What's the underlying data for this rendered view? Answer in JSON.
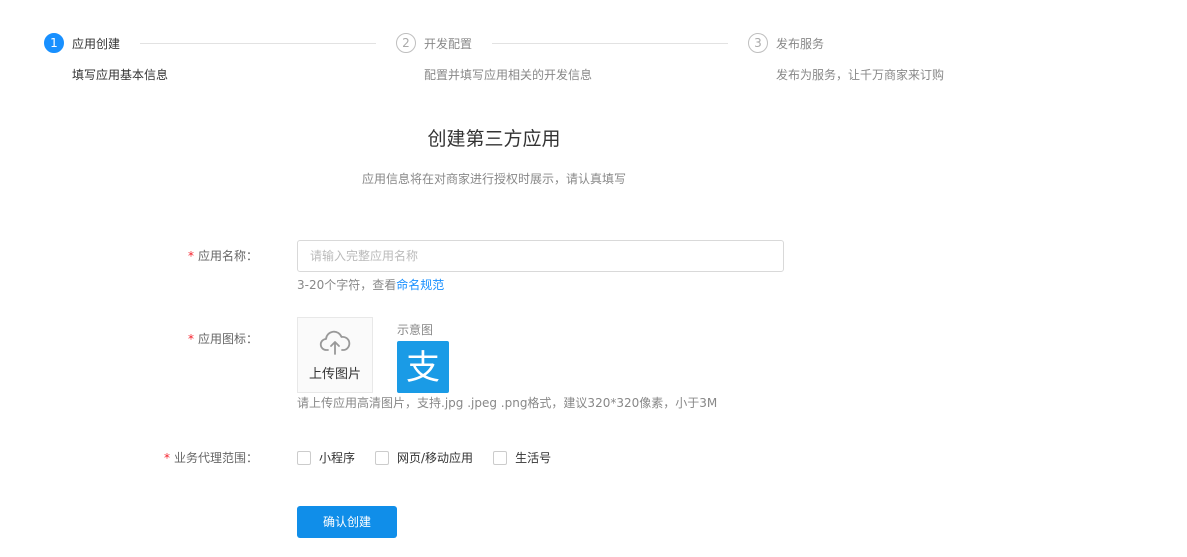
{
  "steps": [
    {
      "number": "1",
      "title": "应用创建",
      "desc": "填写应用基本信息",
      "state": "active"
    },
    {
      "number": "2",
      "title": "开发配置",
      "desc": "配置并填写应用相关的开发信息",
      "state": "inactive"
    },
    {
      "number": "3",
      "title": "发布服务",
      "desc": "发布为服务，让千万商家来订购",
      "state": "inactive"
    }
  ],
  "page": {
    "title": "创建第三方应用",
    "subtitle": "应用信息将在对商家进行授权时展示，请认真填写"
  },
  "form": {
    "required_mark": "*",
    "name": {
      "label": "应用名称：",
      "placeholder": "请输入完整应用名称",
      "value": "",
      "hint_prefix": "3-20个字符，查看",
      "hint_link": "命名规范"
    },
    "icon": {
      "label": "应用图标：",
      "upload_label": "上传图片",
      "upload_icon": "cloud-upload-icon",
      "sample_label": "示意图",
      "sample_logo_icon": "alipay-logo-icon",
      "sample_logo_glyph": "支",
      "hint": "请上传应用高清图片，支持.jpg .jpeg .png格式，建议320*320像素，小于3M"
    },
    "scope": {
      "label": "业务代理范围：",
      "options": [
        {
          "label": "小程序",
          "checked": false
        },
        {
          "label": "网页/移动应用",
          "checked": false
        },
        {
          "label": "生活号",
          "checked": false
        }
      ]
    },
    "submit_label": "确认创建"
  },
  "colors": {
    "accent": "#1890ff",
    "button": "#108ee9",
    "required": "#f5222d",
    "logo": "#1a9be6"
  }
}
